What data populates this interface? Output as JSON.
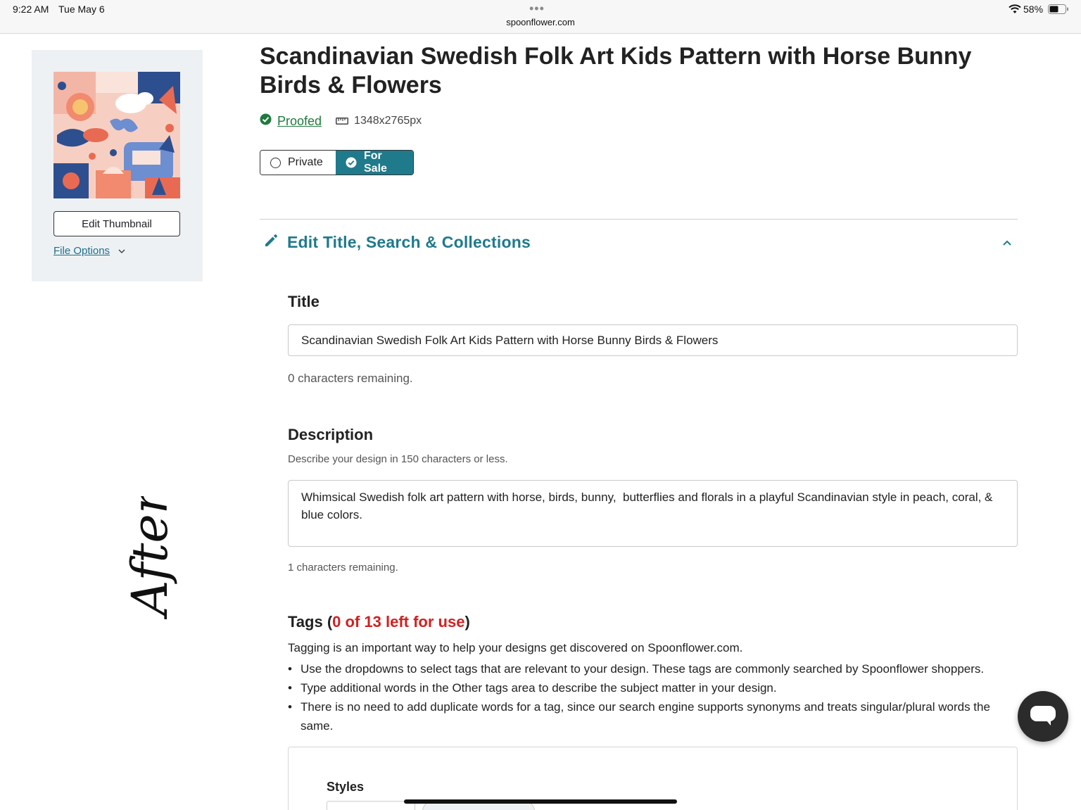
{
  "status_bar": {
    "time": "9:22 AM",
    "date": "Tue May 6",
    "url": "spoonflower.com",
    "battery": "58%"
  },
  "sidebar": {
    "edit_thumbnail_label": "Edit Thumbnail",
    "file_options_label": "File Options"
  },
  "design": {
    "title": "Scandinavian Swedish Folk Art Kids Pattern with Horse Bunny Birds & Flowers",
    "proofed_label": "Proofed",
    "dimensions": "1348x2765px",
    "visibility": {
      "private_label": "Private",
      "for_sale_label": "For Sale",
      "selected": "For Sale"
    }
  },
  "edit_section": {
    "title": "Edit Title, Search & Collections",
    "title_label": "Title",
    "title_value": "Scandinavian Swedish Folk Art Kids Pattern with Horse Bunny Birds & Flowers",
    "title_remaining": "0 characters remaining.",
    "description_label": "Description",
    "description_hint": "Describe your design in 150 characters or less.",
    "description_value": "Whimsical Swedish folk art pattern with horse, birds, bunny,  butterflies and florals in a playful Scandinavian style in peach, coral, & blue colors.",
    "description_remaining": "1 characters remaining.",
    "tags_label": "Tags",
    "tags_left": "0 of 13 left for use",
    "tags_intro": "Tagging is an important way to help your designs get discovered on Spoonflower.com.",
    "tags_bullets": [
      "Use the dropdowns to select tags that are relevant to your design. These tags are commonly searched by Spoonflower shoppers.",
      "Type additional words in the Other tags area to describe the subject matter in your design.",
      "There is no need to add duplicate words for a tag, since our search engine supports synonyms and treats singular/plural words the same."
    ],
    "styles_label": "Styles"
  },
  "annotation": {
    "handwritten_text": "After"
  },
  "colors": {
    "accent_teal": "#1f7a8c",
    "proofed_green": "#1f7a3e",
    "tags_red": "#d32020",
    "panel_bg": "#eef1f4"
  }
}
